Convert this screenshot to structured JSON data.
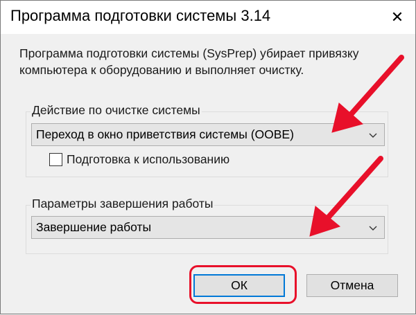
{
  "window": {
    "title": "Программа подготовки системы 3.14",
    "close_glyph": "✕"
  },
  "description": "Программа подготовки системы (SysPrep) убирает привязку компьютера к оборудованию и выполняет очистку.",
  "cleanup_group": {
    "label": "Действие по очистке системы",
    "selected": "Переход в окно приветствия системы (OOBE)",
    "checkbox_label": "Подготовка к использованию",
    "checkbox_checked": false
  },
  "shutdown_group": {
    "label": "Параметры завершения работы",
    "selected": "Завершение работы"
  },
  "buttons": {
    "ok": "ОК",
    "cancel": "Отмена"
  },
  "annotations": {
    "arrow_color": "#e8102a",
    "highlight_color": "#e8102a"
  }
}
